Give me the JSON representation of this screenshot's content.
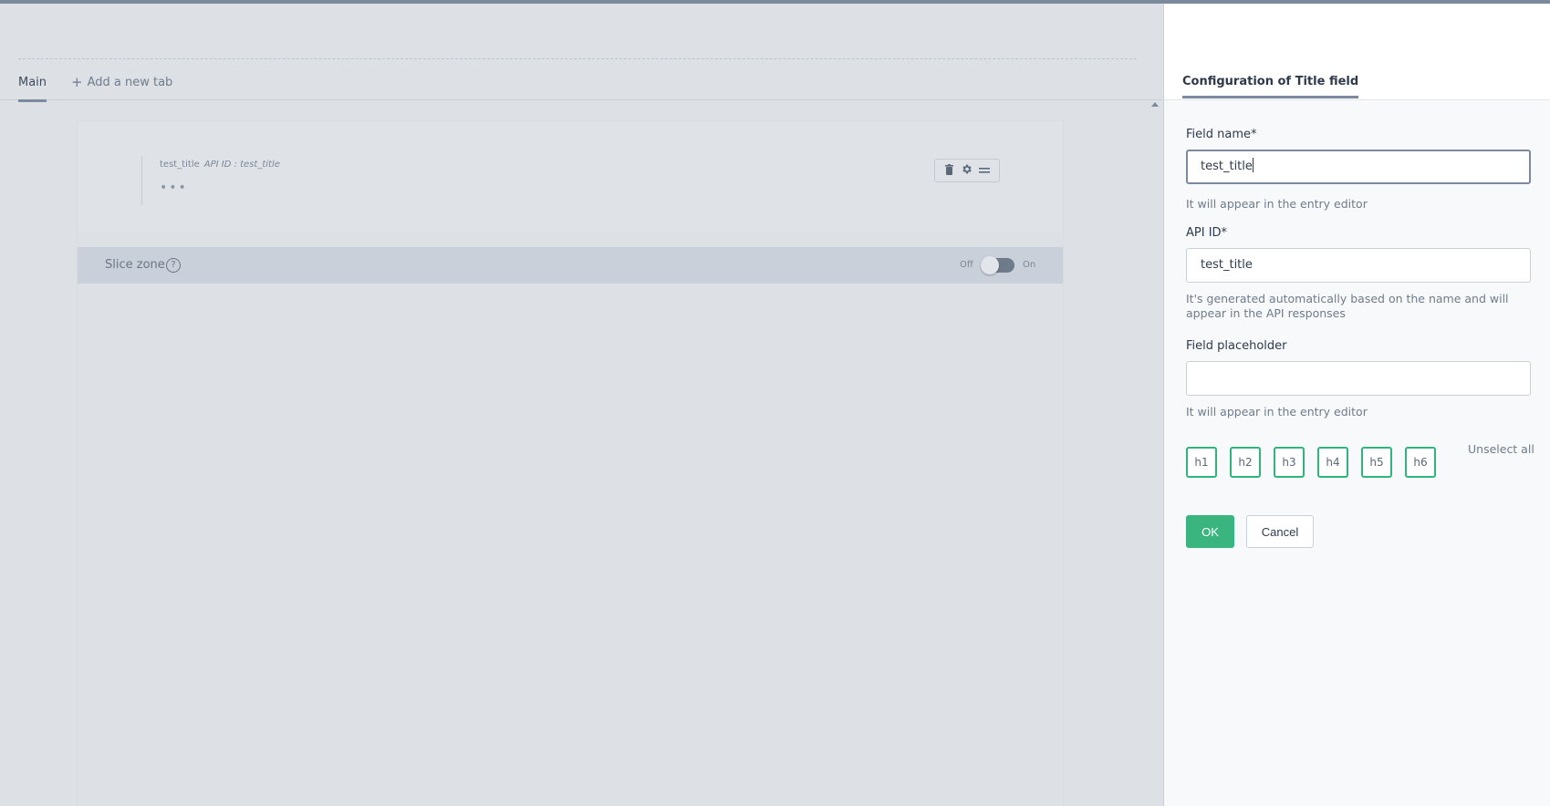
{
  "tabs": {
    "main": "Main",
    "add_tab": "Add a new tab",
    "add_icon": "plus-icon"
  },
  "field": {
    "name": "test_title",
    "api_id": "API ID : test_title",
    "dots": "•••",
    "tools": [
      "trash-icon",
      "gear-icon",
      "drag-handle-icon"
    ]
  },
  "slice_zone": {
    "label": "Slice zone",
    "help": "?",
    "off": "Off",
    "on": "On",
    "enabled": false
  },
  "panel": {
    "title": "Configuration of Title field",
    "field_name": {
      "label": "Field name*",
      "value": "test_title",
      "hint": "It will appear in the entry editor"
    },
    "api_id": {
      "label": "API ID*",
      "value": "test_title",
      "hint": "It's generated automatically based on the name and will appear in the API responses"
    },
    "placeholder": {
      "label": "Field placeholder",
      "value": "",
      "hint": "It will appear in the entry editor"
    },
    "headings": [
      "h1",
      "h2",
      "h3",
      "h4",
      "h5",
      "h6"
    ],
    "unselect_all": "Unselect all",
    "ok": "OK",
    "cancel": "Cancel"
  },
  "colors": {
    "accent_green": "#3bb57f",
    "focus_border": "#7b8a9d"
  }
}
